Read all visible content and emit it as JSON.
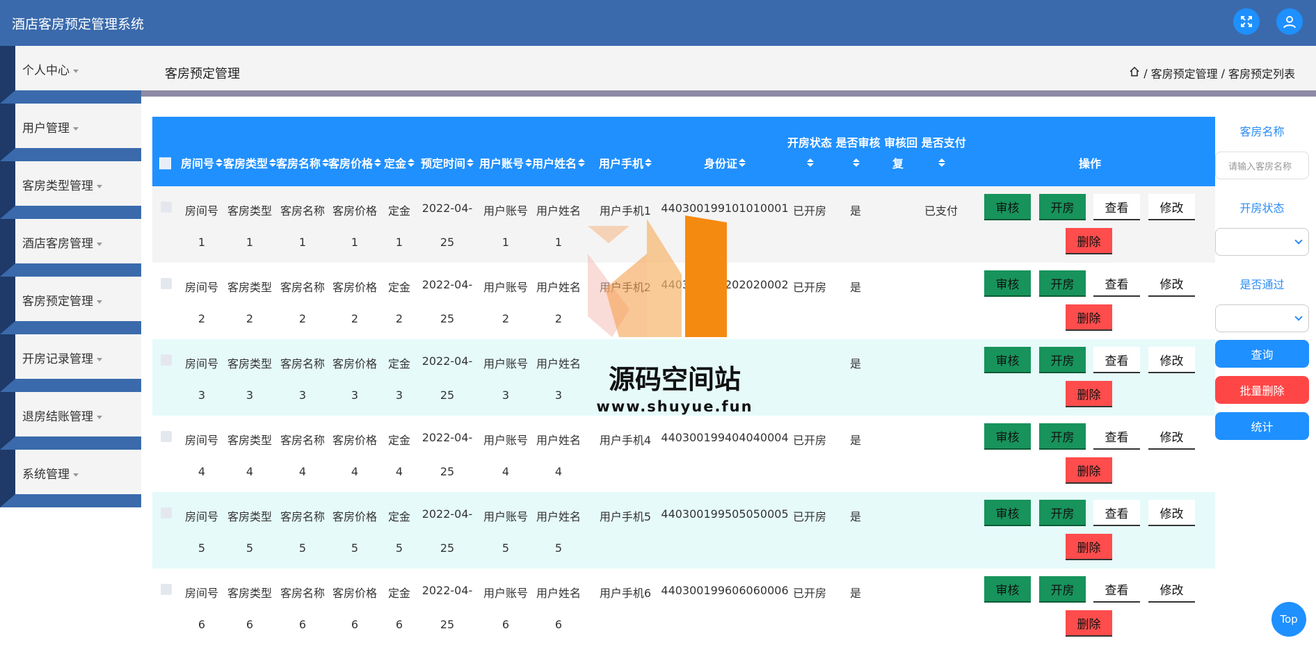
{
  "header": {
    "title": "酒店客房预定管理系统",
    "icons": [
      "fullscreen-icon",
      "user-icon"
    ]
  },
  "sidebar": {
    "items": [
      {
        "label": "个人中心"
      },
      {
        "label": "用户管理"
      },
      {
        "label": "客房类型管理"
      },
      {
        "label": "酒店客房管理"
      },
      {
        "label": "客房预定管理"
      },
      {
        "label": "开房记录管理"
      },
      {
        "label": "退房结账管理"
      },
      {
        "label": "系统管理"
      }
    ]
  },
  "page": {
    "title": "客房预定管理",
    "breadcrumb": [
      "客房预定管理",
      "客房预定列表"
    ]
  },
  "table": {
    "top_header": "开房状态 是否审核  审核回  是否支付",
    "columns": [
      "房间号",
      "客房类型",
      "客房名称",
      "客房价格",
      "定金",
      "预定时间",
      "用户账号",
      "用户姓名",
      "用户手机",
      "身份证",
      "",
      "",
      "复",
      "",
      "操作"
    ],
    "rows": [
      {
        "room_no": "房间号",
        "room_type": "客房类型",
        "room_name": "客房名称",
        "price": "客房价格",
        "deposit": "定金",
        "date": "2022-04-",
        "account": "用户账号",
        "name": "用户姓名",
        "phone": "用户手机1",
        "id_card": "440300199101010001",
        "open": "已开房",
        "audit": "是",
        "pay": "已支付",
        "n": "1",
        "date2": "25"
      },
      {
        "room_no": "房间号",
        "room_type": "客房类型",
        "room_name": "客房名称",
        "price": "客房价格",
        "deposit": "定金",
        "date": "2022-04-",
        "account": "用户账号",
        "name": "用户姓名",
        "phone": "用户手机2",
        "id_card": "440300199202020002",
        "open": "已开房",
        "audit": "是",
        "pay": "",
        "n": "2",
        "date2": "25"
      },
      {
        "room_no": "房间号",
        "room_type": "客房类型",
        "room_name": "客房名称",
        "price": "客房价格",
        "deposit": "定金",
        "date": "2022-04-",
        "account": "用户账号",
        "name": "用户姓名",
        "phone": "",
        "id_card": "",
        "open": "",
        "audit": "是",
        "pay": "",
        "n": "3",
        "date2": "25"
      },
      {
        "room_no": "房间号",
        "room_type": "客房类型",
        "room_name": "客房名称",
        "price": "客房价格",
        "deposit": "定金",
        "date": "2022-04-",
        "account": "用户账号",
        "name": "用户姓名",
        "phone": "用户手机4",
        "id_card": "440300199404040004",
        "open": "已开房",
        "audit": "是",
        "pay": "",
        "n": "4",
        "date2": "25"
      },
      {
        "room_no": "房间号",
        "room_type": "客房类型",
        "room_name": "客房名称",
        "price": "客房价格",
        "deposit": "定金",
        "date": "2022-04-",
        "account": "用户账号",
        "name": "用户姓名",
        "phone": "用户手机5",
        "id_card": "440300199505050005",
        "open": "已开房",
        "audit": "是",
        "pay": "",
        "n": "5",
        "date2": "25"
      },
      {
        "room_no": "房间号",
        "room_type": "客房类型",
        "room_name": "客房名称",
        "price": "客房价格",
        "deposit": "定金",
        "date": "2022-04-",
        "account": "用户账号",
        "name": "用户姓名",
        "phone": "用户手机6",
        "id_card": "440300199606060006",
        "open": "已开房",
        "audit": "是",
        "pay": "",
        "n": "6",
        "date2": "25"
      }
    ],
    "actions": {
      "audit": "审核",
      "open": "开房",
      "view": "查看",
      "edit": "修改",
      "delete": "删除"
    }
  },
  "search": {
    "room_name_label": "客房名称",
    "room_name_placeholder": "请输入客房名称",
    "open_status_label": "开房状态",
    "pass_label": "是否通过",
    "query_button": "查询",
    "batch_delete_button": "批量删除",
    "stats_button": "统计"
  },
  "top_button": "Top",
  "watermark": {
    "title": "源码空间站",
    "url": "www.shuyue.fun"
  }
}
